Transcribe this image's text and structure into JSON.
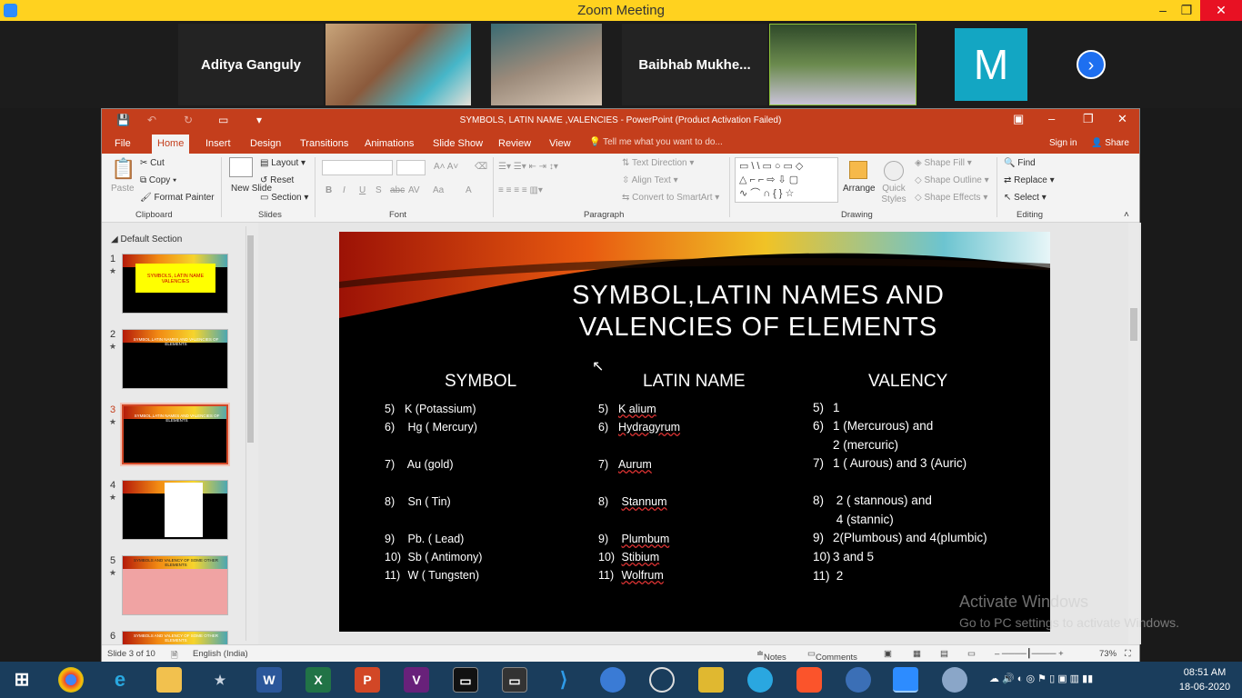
{
  "zoom": {
    "window_title": "Zoom Meeting",
    "participants": [
      {
        "name": "Aditya Ganguly"
      },
      {
        "name": "Baibhab  Mukhe..."
      },
      {
        "name": "M"
      }
    ]
  },
  "ppt": {
    "window_title": "SYMBOLS, LATIN NAME ,VALENCIES  -  PowerPoint (Product Activation Failed)",
    "tabs": [
      "File",
      "Home",
      "Insert",
      "Design",
      "Transitions",
      "Animations",
      "Slide Show",
      "Review",
      "View"
    ],
    "tell_me": "Tell me what you want to do...",
    "sign_in": "Sign in",
    "share": "Share",
    "ribbon": {
      "clipboard": {
        "paste": "Paste",
        "cut": "Cut",
        "copy": "Copy",
        "format_painter": "Format Painter",
        "label": "Clipboard"
      },
      "slides": {
        "new_slide": "New Slide",
        "layout": "Layout",
        "reset": "Reset",
        "section": "Section",
        "label": "Slides"
      },
      "font": {
        "label": "Font",
        "bold": "B",
        "italic": "I",
        "underline": "U",
        "shadow": "S",
        "strike": "abc",
        "spacing": "AV",
        "case": "Aa",
        "color": "A"
      },
      "paragraph": {
        "label": "Paragraph",
        "text_direction": "Text Direction",
        "align_text": "Align Text",
        "convert_smartart": "Convert to SmartArt"
      },
      "drawing": {
        "label": "Drawing",
        "arrange": "Arrange",
        "quick_styles": "Quick Styles",
        "shape_fill": "Shape Fill",
        "shape_outline": "Shape Outline",
        "shape_effects": "Shape Effects"
      },
      "editing": {
        "label": "Editing",
        "find": "Find",
        "replace": "Replace",
        "select": "Select"
      }
    },
    "section_name": "Default Section",
    "thumbnails": [
      {
        "num": "1",
        "text": "SYMBOLS, LATIN NAME VALENCIES"
      },
      {
        "num": "2",
        "text": "SYMBOL,LATIN NAMES AND VALENCIES OF ELEMENTS"
      },
      {
        "num": "3",
        "text": "SYMBOL,LATIN NAMES AND VALENCIES OF ELEMENTS"
      },
      {
        "num": "4",
        "text": ""
      },
      {
        "num": "5",
        "text": "SYMBOLS AND VALENCY OF SOME OTHER ELEMENTS"
      },
      {
        "num": "6",
        "text": "SYMBOLS AND VALENCY OF SOME OTHER ELEMENTS"
      }
    ],
    "slide": {
      "title": "SYMBOL,LATIN NAMES AND VALENCIES OF ELEMENTS",
      "headers": {
        "symbol": "SYMBOL",
        "latin": "LATIN NAME",
        "valency": "VALENCY"
      },
      "symbols": [
        {
          "num": "5)",
          "text": "K (Potassium)"
        },
        {
          "num": "6)",
          "text": "Hg ( Mercury)"
        },
        {
          "num": "7)",
          "text": "Au (gold)"
        },
        {
          "num": "8)",
          "text": "Sn ( Tin)"
        },
        {
          "num": "9)",
          "text": "Pb. ( Lead)"
        },
        {
          "num": "10)",
          "text": "Sb ( Antimony)"
        },
        {
          "num": "11)",
          "text": "W ( Tungsten)"
        }
      ],
      "latin": [
        {
          "num": "5)",
          "text": "K alium"
        },
        {
          "num": "6)",
          "text": "Hydragyrum"
        },
        {
          "num": "7)",
          "text": "Aurum"
        },
        {
          "num": "8)",
          "text": "Stannum"
        },
        {
          "num": "9)",
          "text": "Plumbum"
        },
        {
          "num": "10)",
          "text": "Stibium"
        },
        {
          "num": "11)",
          "text": "Wolfrum"
        }
      ],
      "valency": [
        {
          "num": "5)",
          "text": "1"
        },
        {
          "num": "6)",
          "text": "1 (Mercurous) and"
        },
        {
          "num": "",
          "text": "2 (mercuric)"
        },
        {
          "num": "7)",
          "text": "1 ( Aurous) and 3 (Auric)"
        },
        {
          "num": "8)",
          "text": "2 ( stannous) and"
        },
        {
          "num": "",
          "text": "4  (stannic)"
        },
        {
          "num": "9)",
          "text": "2(Plumbous) and 4(plumbic)"
        },
        {
          "num": "10)",
          "text": "3  and 5"
        },
        {
          "num": "11)",
          "text": "2"
        }
      ]
    },
    "status": {
      "slide_info": "Slide 3 of 10",
      "language": "English (India)",
      "notes": "Notes",
      "comments": "Comments",
      "zoom": "73%"
    }
  },
  "watermark": {
    "line1": "Activate Windows",
    "line2": "Go to PC settings to activate Windows."
  },
  "taskbar": {
    "time": "08:51 AM",
    "date": "18-06-2020"
  }
}
